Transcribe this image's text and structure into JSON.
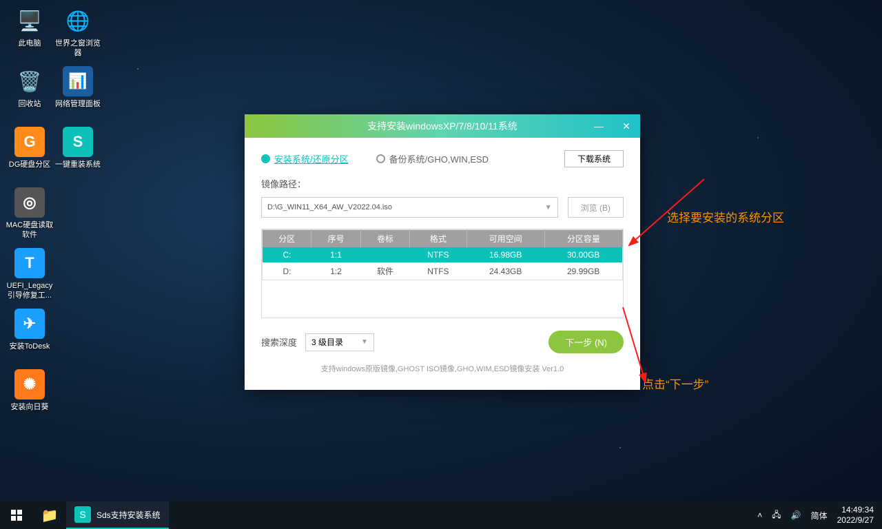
{
  "desktop": {
    "col1": [
      {
        "label": "此电脑",
        "glyph": "🖥️",
        "bg": "transparent"
      },
      {
        "label": "回收站",
        "glyph": "🗑️",
        "bg": "transparent"
      },
      {
        "label": "DG硬盘分区",
        "glyph": "G",
        "bg": "#ff8c1a"
      },
      {
        "label": "MAC硬盘读取软件",
        "glyph": "◎",
        "bg": "#555"
      },
      {
        "label": "UEFI_Legacy引导修复工...",
        "glyph": "T",
        "bg": "#1a9fff"
      },
      {
        "label": "安装ToDesk",
        "glyph": "✈",
        "bg": "#1a9fff"
      },
      {
        "label": "安装向日葵",
        "glyph": "✺",
        "bg": "#ff7a1a"
      }
    ],
    "col2": [
      {
        "label": "世界之窗浏览器",
        "glyph": "🌐",
        "bg": "transparent"
      },
      {
        "label": "网络管理面板",
        "glyph": "📊",
        "bg": "#1a5f9f"
      },
      {
        "label": "一键重装系统",
        "glyph": "S",
        "bg": "#0ec1b8"
      }
    ]
  },
  "window": {
    "title": "支持安装windowsXP/7/8/10/11系统",
    "radio_install": "安装系统/还原分区",
    "radio_backup": "备份系统/GHO,WIN,ESD",
    "download_btn": "下载系统",
    "path_label": "镜像路径：",
    "path_value": "D:\\G_WIN11_X64_AW_V2022.04.iso",
    "browse_btn": "浏览 (B)",
    "headers": [
      "分区",
      "序号",
      "卷标",
      "格式",
      "可用空间",
      "分区容量"
    ],
    "rows": [
      {
        "drive": "C:",
        "idx": "1:1",
        "label": "",
        "fmt": "NTFS",
        "free": "16.98GB",
        "cap": "30.00GB",
        "selected": true
      },
      {
        "drive": "D:",
        "idx": "1:2",
        "label": "软件",
        "fmt": "NTFS",
        "free": "24.43GB",
        "cap": "29.99GB",
        "selected": false
      }
    ],
    "depth_label": "搜索深度",
    "depth_value": "3 级目录",
    "next_btn": "下一步 (N)",
    "footnote": "支持windows原版镜像,GHOST ISO镜像,GHO,WIM,ESD镜像安装 Ver1.0"
  },
  "annotations": {
    "a1": "选择要安装的系统分区",
    "a2": "点击“下一步”"
  },
  "taskbar": {
    "task_label": "Sds支持安装系统",
    "ime": "简体",
    "time": "14:49:34",
    "date": "2022/9/27"
  }
}
